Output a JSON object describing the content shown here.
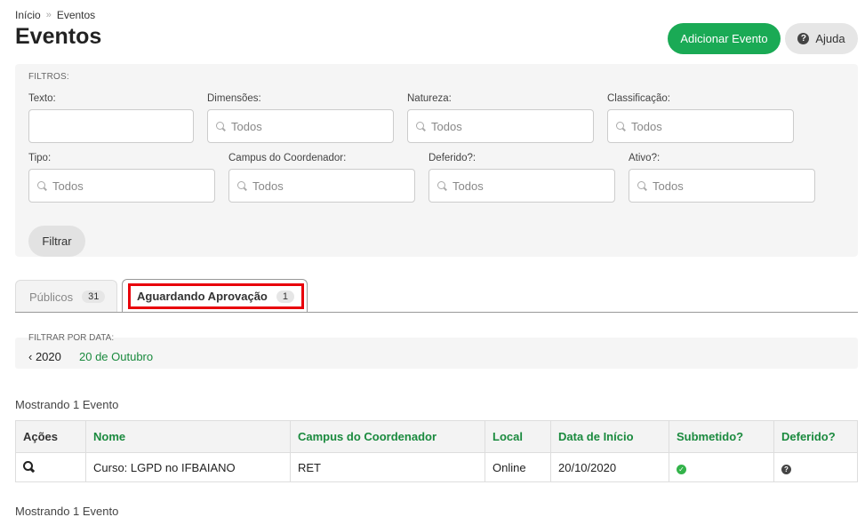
{
  "breadcrumb": {
    "home": "Início",
    "separator": "»",
    "current": "Eventos"
  },
  "page": {
    "title": "Eventos"
  },
  "actions": {
    "add_event": "Adicionar Evento",
    "help": "Ajuda"
  },
  "filters": {
    "title": "FILTROS:",
    "fields": [
      {
        "label": "Texto:",
        "value": "",
        "placeholder": ""
      },
      {
        "label": "Dimensões:",
        "value": "Todos"
      },
      {
        "label": "Natureza:",
        "value": "Todos"
      },
      {
        "label": "Classificação:",
        "value": "Todos"
      },
      {
        "label": "Tipo:",
        "value": "Todos"
      },
      {
        "label": "Campus do Coordenador:",
        "value": "Todos"
      },
      {
        "label": "Deferido?:",
        "value": "Todos"
      },
      {
        "label": "Ativo?:",
        "value": "Todos"
      }
    ],
    "submit": "Filtrar"
  },
  "tabs": [
    {
      "label": "Públicos",
      "count": "31",
      "active": false
    },
    {
      "label": "Aguardando Aprovação",
      "count": "1",
      "active": true
    }
  ],
  "date_filter": {
    "title": "FILTRAR POR DATA:",
    "year": "‹ 2020",
    "day": "20 de Outubro"
  },
  "results": {
    "summary": "Mostrando 1 Evento",
    "columns": [
      "Ações",
      "Nome",
      "Campus do Coordenador",
      "Local",
      "Data de Início",
      "Submetido?",
      "Deferido?"
    ],
    "rows": [
      {
        "nome": "Curso: LGPD no IFBAIANO",
        "campus": "RET",
        "local": "Online",
        "data_inicio": "20/10/2020",
        "submetido": "check-icon",
        "deferido": "question-icon"
      }
    ]
  },
  "colors": {
    "primary": "#1aaa55",
    "link": "#1a8a3e",
    "highlight": "#e8000b"
  }
}
